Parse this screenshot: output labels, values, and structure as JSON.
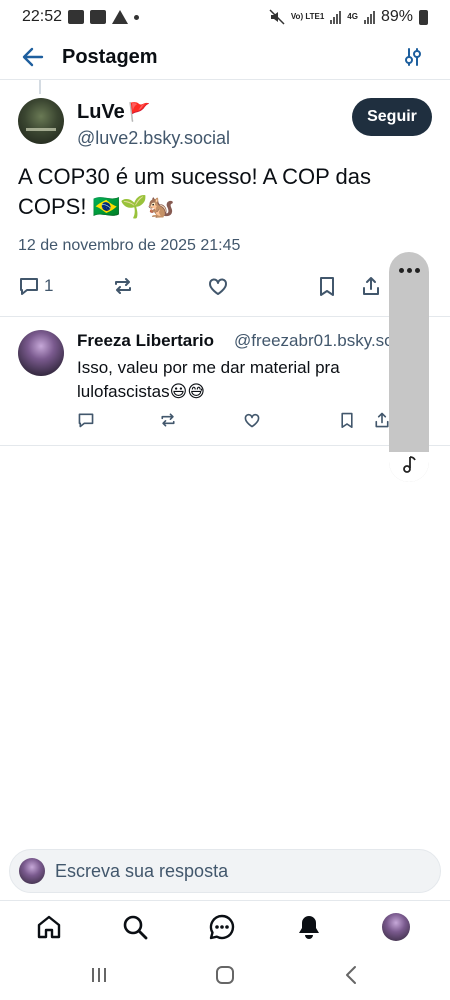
{
  "status_bar": {
    "time": "22:52",
    "network_label": "Vo) LTE1",
    "network_type": "4G",
    "battery": "89%"
  },
  "header": {
    "title": "Postagem",
    "back_icon": "arrow-left-icon",
    "filter_icon": "sliders-icon"
  },
  "post": {
    "author_name": "LuVe",
    "author_flag": "🚩",
    "author_handle": "@luve2.bsky.social",
    "follow_label": "Seguir",
    "text": "A COP30 é um sucesso! A COP das COPS! 🇧🇷🌱🐿️",
    "date": "12 de novembro de 2025 21:45",
    "reply_count": "1",
    "actions": [
      "reply-icon",
      "repost-icon",
      "like-icon",
      "bookmark-icon",
      "share-icon"
    ]
  },
  "reply": {
    "author_name": "Freeza Libertario",
    "author_handle": "@freezabr01.bsky.social",
    "text": "Isso,  valeu por me dar material pra lulofascistas😃😅"
  },
  "composer": {
    "placeholder": "Escreva sua resposta"
  },
  "bottom_nav": [
    "home-icon",
    "search-icon",
    "chat-icon",
    "notifications-icon",
    "profile-avatar"
  ],
  "colors": {
    "accent": "#1f2f3f",
    "muted_text": "#42576c",
    "divider": "#e4e8ec",
    "back_arrow": "#1e5f9e"
  }
}
